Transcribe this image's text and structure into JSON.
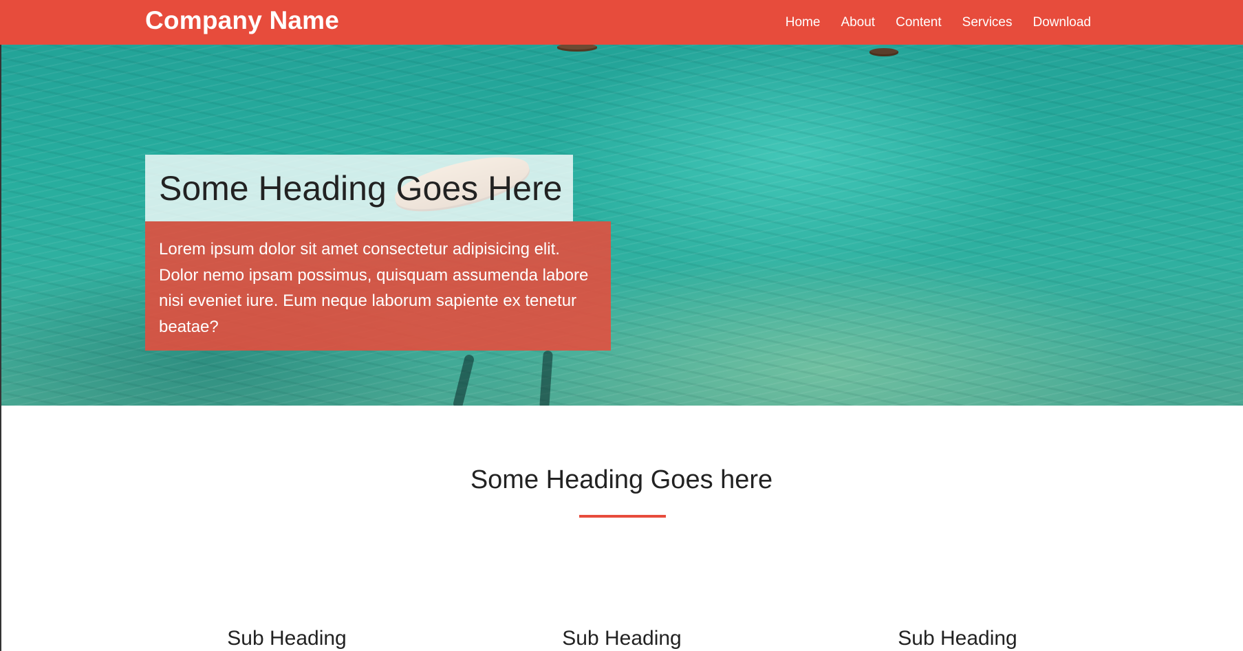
{
  "navbar": {
    "brand": "Company Name",
    "links": [
      {
        "label": "Home"
      },
      {
        "label": "About"
      },
      {
        "label": "Content"
      },
      {
        "label": "Services"
      },
      {
        "label": "Download"
      }
    ]
  },
  "hero": {
    "heading": "Some Heading Goes Here",
    "text": "Lorem ipsum dolor sit amet consectetur adipisicing elit. Dolor nemo ipsam possimus, quisquam assumenda labore nisi eveniet iure. Eum neque laborum sapiente ex tenetur beatae?"
  },
  "section": {
    "heading": "Some Heading Goes here",
    "sub_headings": [
      {
        "label": "Sub Heading"
      },
      {
        "label": "Sub Heading"
      },
      {
        "label": "Sub Heading"
      }
    ]
  },
  "colors": {
    "accent": "#e74c3c",
    "text": "#222222",
    "background": "#ffffff"
  }
}
